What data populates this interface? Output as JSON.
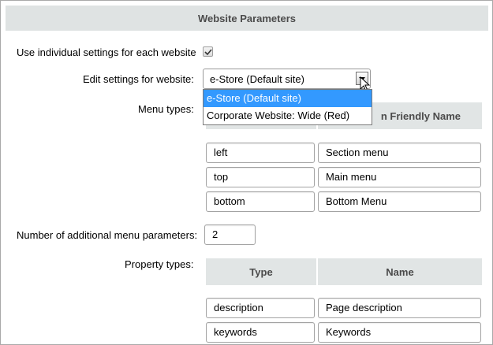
{
  "header": {
    "title": "Website Parameters"
  },
  "individual": {
    "label": "Use individual settings for each website",
    "checked": true
  },
  "website": {
    "label": "Edit settings for website:",
    "selected": "e-Store (Default site)",
    "options": [
      "e-Store (Default site)",
      "Corporate Website: Wide (Red)"
    ]
  },
  "menu_types": {
    "label": "Menu types:",
    "col_name_visible": "n Friendly Name",
    "rows": [
      {
        "type": "left",
        "name": "Section menu"
      },
      {
        "type": "top",
        "name": "Main menu"
      },
      {
        "type": "bottom",
        "name": "Bottom Menu"
      }
    ]
  },
  "additional": {
    "label": "Number of additional menu parameters:",
    "value": "2"
  },
  "property_types": {
    "label": "Property types:",
    "col_type": "Type",
    "col_name": "Name",
    "rows": [
      {
        "type": "description",
        "name": "Page description"
      },
      {
        "type": "keywords",
        "name": "Keywords"
      }
    ]
  }
}
